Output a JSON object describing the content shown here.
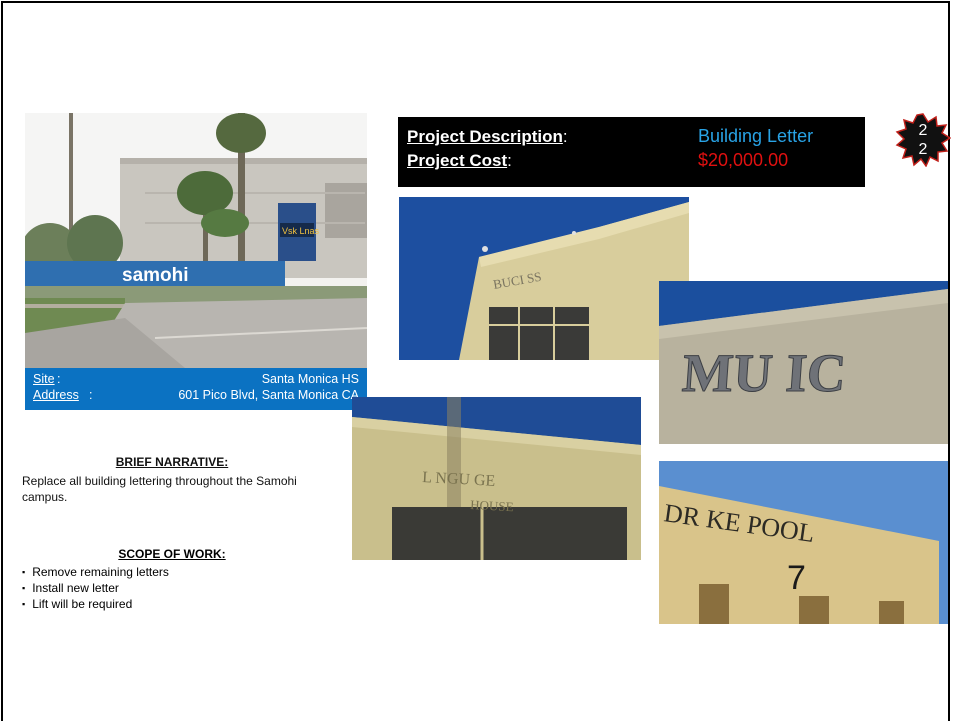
{
  "project": {
    "description_label": "Project Description",
    "description_value": "Building Letter",
    "cost_label": "Project Cost",
    "cost_value": "$20,000.00",
    "colon": ":"
  },
  "badge": {
    "line1": "2",
    "line2": "2"
  },
  "site": {
    "site_label": "Site",
    "site_value": "Santa Monica HS",
    "address_label": "Address",
    "address_value": "601 Pico Blvd, Santa Monica CA",
    "colon": ":"
  },
  "narrative": {
    "heading": "BRIEF NARRATIVE:",
    "text": "Replace all building lettering  throughout the Samohi campus."
  },
  "scope": {
    "heading": "SCOPE OF WORK:",
    "items": [
      "Remove remaining letters",
      "Install new letter",
      "Lift will be required"
    ]
  },
  "photos": {
    "main_sign": "samohi",
    "marquee": "Vsk Lnas",
    "bucs": "BUCI  SS",
    "music": "MU  IC",
    "lang_line1": "L   NGU GE",
    "lang_line2": "HOUSE",
    "drake": "DR  KE POOL",
    "drake_num": "7"
  },
  "colors": {
    "site_box": "#0b72c2",
    "description_value": "#29a3e6",
    "cost_value": "#e01010"
  }
}
